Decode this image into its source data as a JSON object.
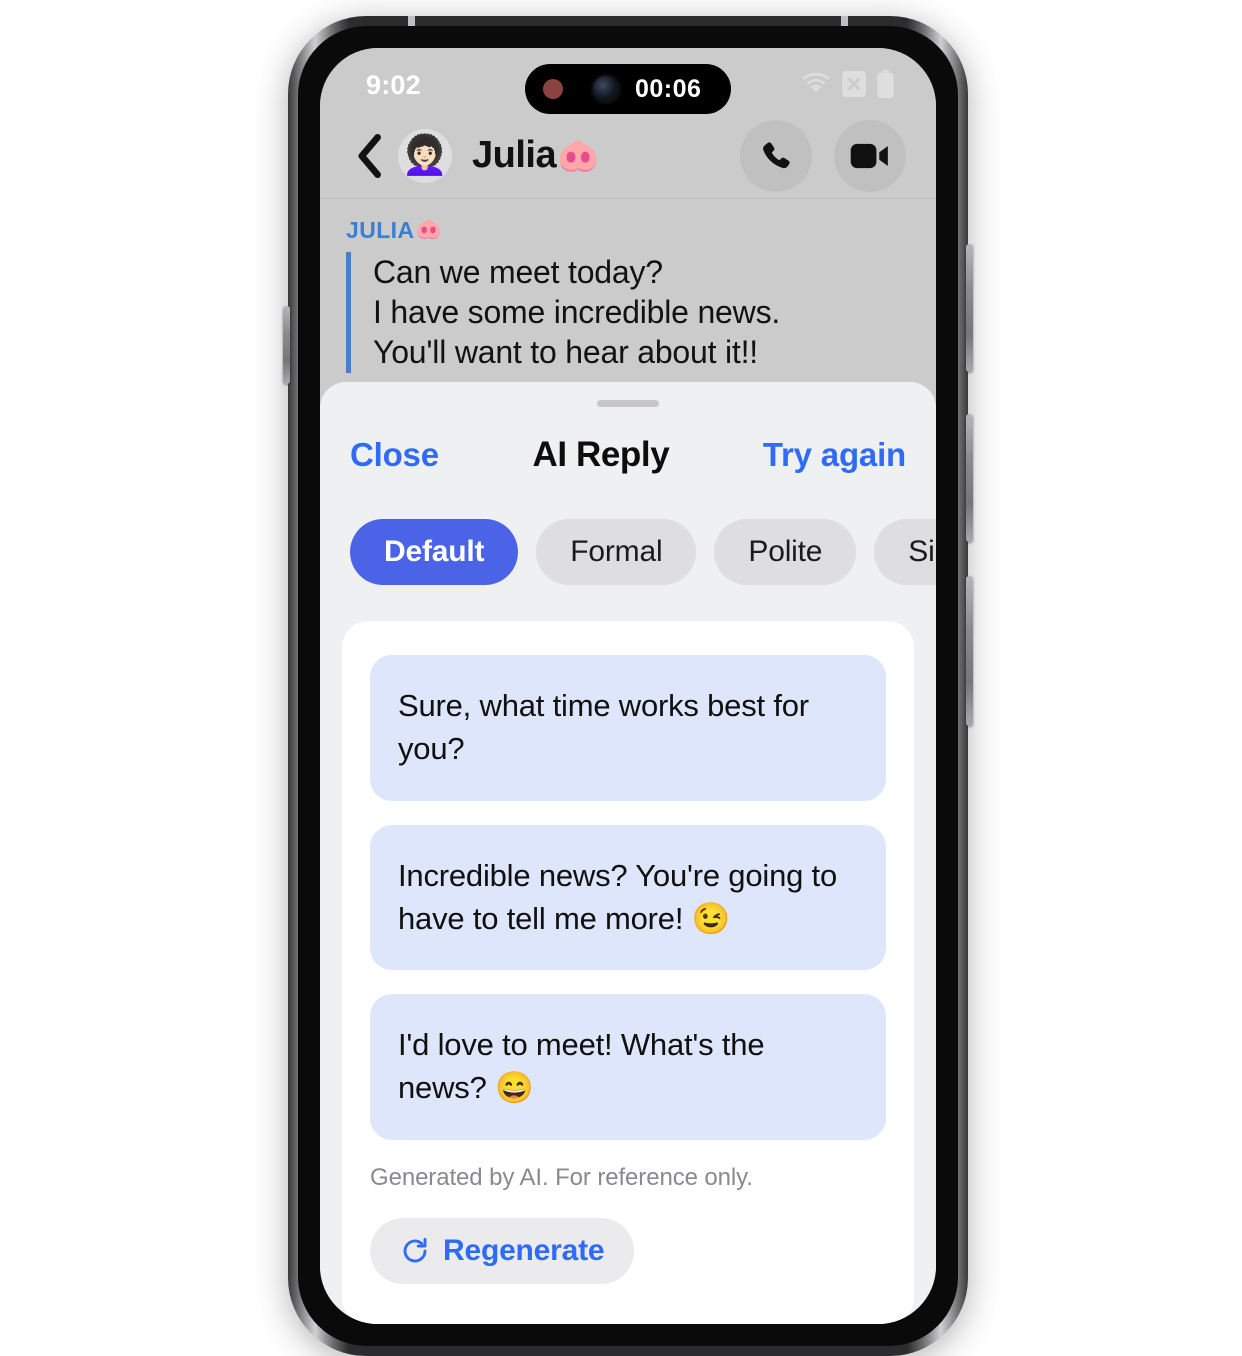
{
  "theme": {
    "chat_background": "#CBCBCB",
    "sheet_background": "#EFF0F2",
    "accent_blue": "#2F6BF6",
    "chip_selected_blue": "#4A63E7",
    "bubble_blue": "#DDE6FA",
    "quote_bar_blue": "#4A7FC8",
    "sender_label_blue": "#3B7FD4",
    "card_white": "#FFFFFF"
  },
  "status_bar": {
    "time": "9:02",
    "icons": [
      "wifi-icon",
      "sim-disabled-icon",
      "battery-icon"
    ],
    "dynamic_island": {
      "recording_indicator": "record-dot-icon",
      "camera": "camera-lens-icon",
      "timer": "00:06"
    }
  },
  "chat_header": {
    "back_icon": "chevron-left-icon",
    "avatar_emoji": "👩🏻‍🦱",
    "contact_name": "Julia",
    "contact_name_emoji": "🐽",
    "actions": [
      {
        "name": "voice-call-button",
        "icon": "phone-icon"
      },
      {
        "name": "video-call-button",
        "icon": "video-camera-icon"
      }
    ]
  },
  "conversation": {
    "quoted": {
      "sender": "JULIA",
      "sender_emoji": "🐽",
      "lines": [
        "Can we meet today?",
        "I have some incredible news.",
        "You'll want to hear about it!!"
      ]
    }
  },
  "ai_sheet": {
    "close_label": "Close",
    "title": "AI Reply",
    "try_again_label": "Try again",
    "tone_chips": [
      {
        "label": "Default",
        "selected": true
      },
      {
        "label": "Formal",
        "selected": false
      },
      {
        "label": "Polite",
        "selected": false
      },
      {
        "label": "Sincere",
        "selected": false
      },
      {
        "label": "",
        "selected": false
      }
    ],
    "replies": [
      "Sure, what time works best for you?",
      "Incredible news? You're going to have to tell me more! 😉",
      "I'd love to meet! What's the news? 😄"
    ],
    "disclaimer": "Generated by AI. For reference only.",
    "regenerate_label": "Regenerate",
    "regenerate_icon": "refresh-icon"
  }
}
